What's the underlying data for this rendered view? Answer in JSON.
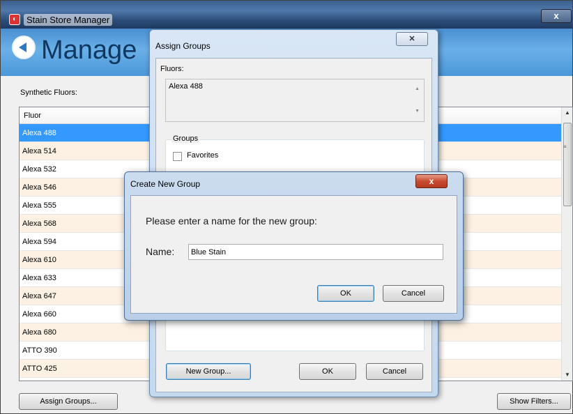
{
  "window": {
    "title": "Stain Store Manager",
    "close_glyph": "x"
  },
  "header": {
    "heading": "Manage",
    "back_icon": "back-arrow-icon"
  },
  "main": {
    "list_label": "Synthetic Fluors:",
    "column_header": "Fluor",
    "rows": [
      "Alexa 488",
      "Alexa 514",
      "Alexa 532",
      "Alexa 546",
      "Alexa 555",
      "Alexa 568",
      "Alexa 594",
      "Alexa 610",
      "Alexa 633",
      "Alexa 647",
      "Alexa 660",
      "Alexa 680",
      "ATTO 390",
      "ATTO 425"
    ],
    "selected_row": "Alexa 488",
    "assign_groups_label": "Assign Groups...",
    "show_filters_label": "Show Filters..."
  },
  "assign_dialog": {
    "title": "Assign Groups",
    "close_glyph": "✕",
    "fluors_label": "Fluors:",
    "fluors_value": "Alexa 488",
    "groups_label": "Groups",
    "favorites_label": "Favorites",
    "new_group_label": "New Group...",
    "ok_label": "OK",
    "cancel_label": "Cancel"
  },
  "create_dialog": {
    "title": "Create New Group",
    "close_glyph": "x",
    "prompt": "Please enter a name for the new group:",
    "name_label": "Name:",
    "name_value": "Blue Stain",
    "ok_label": "OK",
    "cancel_label": "Cancel"
  },
  "colors": {
    "selection": "#3399ff",
    "alt_row": "#fcf1e3",
    "header_band": "#4a97d8"
  }
}
